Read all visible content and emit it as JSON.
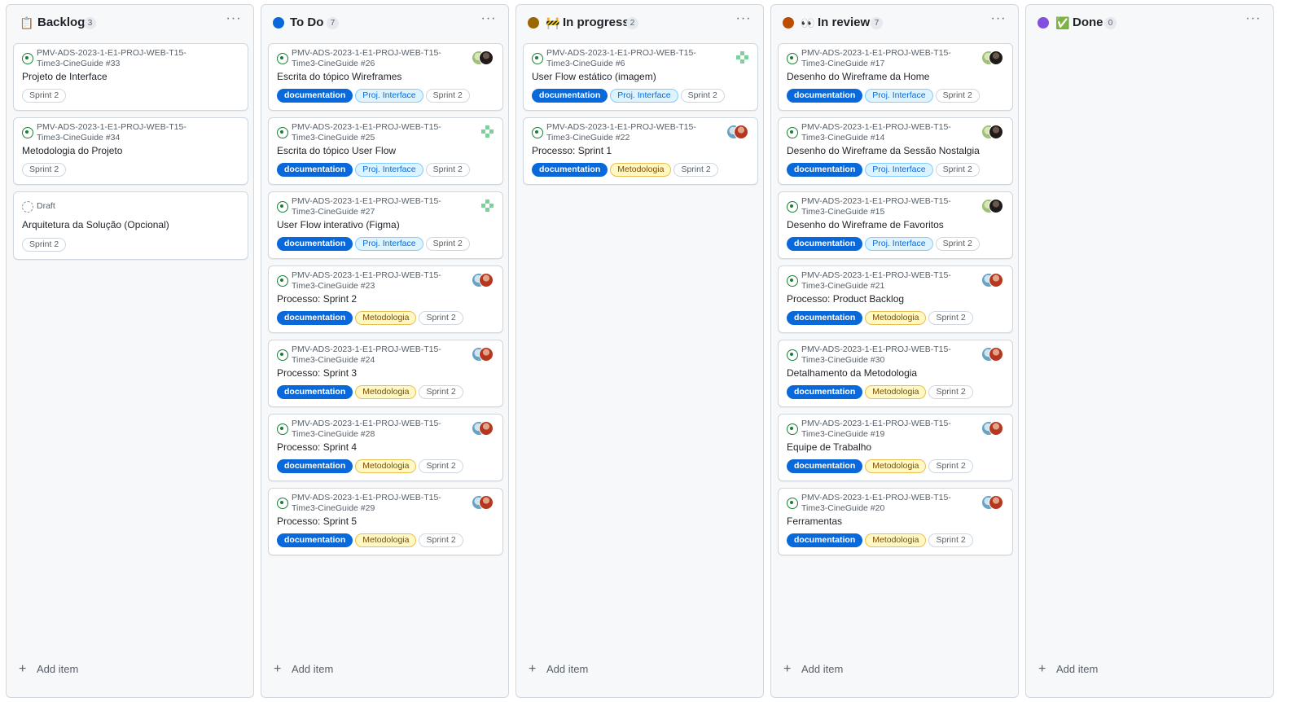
{
  "colors": {
    "todo": "#0969da",
    "in_progress": "#9a6700",
    "in_review": "#bc4c00",
    "done": "#8250df",
    "issue_open": "#1a7f37",
    "label_documentation": "#0969da",
    "label_proj_interface": "#ddf4ff",
    "label_metodologia": "#fff8c5"
  },
  "add_item_label": "Add item",
  "columns": [
    {
      "title": "Backlog",
      "count": "3",
      "emoji": "📋",
      "status_color": "",
      "cards": [
        {
          "repo": "PMV-ADS-2023-1-E1-PROJ-WEB-T15-Time3-CineGuide #33",
          "title": "Projeto de Interface",
          "labels": [
            "Sprint 2"
          ]
        },
        {
          "repo": "PMV-ADS-2023-1-E1-PROJ-WEB-T15-Time3-CineGuide #34",
          "title": "Metodologia do Projeto",
          "labels": [
            "Sprint 2"
          ]
        },
        {
          "draft": "Draft",
          "title": "Arquitetura da Solução (Opcional)",
          "labels": [
            "Sprint 2"
          ]
        }
      ]
    },
    {
      "title": "To Do",
      "count": "7",
      "emoji": "",
      "status_color": "#0969da",
      "cards": [
        {
          "repo": "PMV-ADS-2023-1-E1-PROJ-WEB-T15-Time3-CineGuide #26",
          "title": "Escrita do tópico Wireframes",
          "labels": [
            "documentation",
            "Proj. Interface",
            "Sprint 2"
          ]
        },
        {
          "repo": "PMV-ADS-2023-1-E1-PROJ-WEB-T15-Time3-CineGuide #25",
          "title": "Escrita do tópico User Flow",
          "labels": [
            "documentation",
            "Proj. Interface",
            "Sprint 2"
          ]
        },
        {
          "repo": "PMV-ADS-2023-1-E1-PROJ-WEB-T15-Time3-CineGuide #27",
          "title": "User Flow interativo (Figma)",
          "labels": [
            "documentation",
            "Proj. Interface",
            "Sprint 2"
          ]
        },
        {
          "repo": "PMV-ADS-2023-1-E1-PROJ-WEB-T15-Time3-CineGuide #23",
          "title": "Processo: Sprint 2",
          "labels": [
            "documentation",
            "Metodologia",
            "Sprint 2"
          ]
        },
        {
          "repo": "PMV-ADS-2023-1-E1-PROJ-WEB-T15-Time3-CineGuide #24",
          "title": "Processo: Sprint 3",
          "labels": [
            "documentation",
            "Metodologia",
            "Sprint 2"
          ]
        },
        {
          "repo": "PMV-ADS-2023-1-E1-PROJ-WEB-T15-Time3-CineGuide #28",
          "title": "Processo: Sprint 4",
          "labels": [
            "documentation",
            "Metodologia",
            "Sprint 2"
          ]
        },
        {
          "repo": "PMV-ADS-2023-1-E1-PROJ-WEB-T15-Time3-CineGuide #29",
          "title": "Processo: Sprint 5",
          "labels": [
            "documentation",
            "Metodologia",
            "Sprint 2"
          ]
        }
      ]
    },
    {
      "title": "In progress",
      "count": "2",
      "emoji": "🚧",
      "status_color": "#9a6700",
      "cards": [
        {
          "repo": "PMV-ADS-2023-1-E1-PROJ-WEB-T15-Time3-CineGuide #6",
          "title": "User Flow estático (imagem)",
          "labels": [
            "documentation",
            "Proj. Interface",
            "Sprint 2"
          ]
        },
        {
          "repo": "PMV-ADS-2023-1-E1-PROJ-WEB-T15-Time3-CineGuide #22",
          "title": "Processo: Sprint 1",
          "labels": [
            "documentation",
            "Metodologia",
            "Sprint 2"
          ]
        }
      ]
    },
    {
      "title": "In review",
      "count": "7",
      "emoji": "👀",
      "status_color": "#bc4c00",
      "cards": [
        {
          "repo": "PMV-ADS-2023-1-E1-PROJ-WEB-T15-Time3-CineGuide #17",
          "title": "Desenho do Wireframe da Home",
          "labels": [
            "documentation",
            "Proj. Interface",
            "Sprint 2"
          ]
        },
        {
          "repo": "PMV-ADS-2023-1-E1-PROJ-WEB-T15-Time3-CineGuide #14",
          "title": "Desenho do Wireframe da Sessão Nostalgia",
          "labels": [
            "documentation",
            "Proj. Interface",
            "Sprint 2"
          ]
        },
        {
          "repo": "PMV-ADS-2023-1-E1-PROJ-WEB-T15-Time3-CineGuide #15",
          "title": "Desenho do Wireframe de Favoritos",
          "labels": [
            "documentation",
            "Proj. Interface",
            "Sprint 2"
          ]
        },
        {
          "repo": "PMV-ADS-2023-1-E1-PROJ-WEB-T15-Time3-CineGuide #21",
          "title": "Processo: Product Backlog",
          "labels": [
            "documentation",
            "Metodologia",
            "Sprint 2"
          ]
        },
        {
          "repo": "PMV-ADS-2023-1-E1-PROJ-WEB-T15-Time3-CineGuide #30",
          "title": "Detalhamento da Metodologia",
          "labels": [
            "documentation",
            "Metodologia",
            "Sprint 2"
          ]
        },
        {
          "repo": "PMV-ADS-2023-1-E1-PROJ-WEB-T15-Time3-CineGuide #19",
          "title": "Equipe de Trabalho",
          "labels": [
            "documentation",
            "Metodologia",
            "Sprint 2"
          ]
        },
        {
          "repo": "PMV-ADS-2023-1-E1-PROJ-WEB-T15-Time3-CineGuide #20",
          "title": "Ferramentas",
          "labels": [
            "documentation",
            "Metodologia",
            "Sprint 2"
          ]
        }
      ]
    },
    {
      "title": "Done",
      "count": "0",
      "emoji": "✅",
      "status_color": "#8250df",
      "cards": []
    }
  ]
}
